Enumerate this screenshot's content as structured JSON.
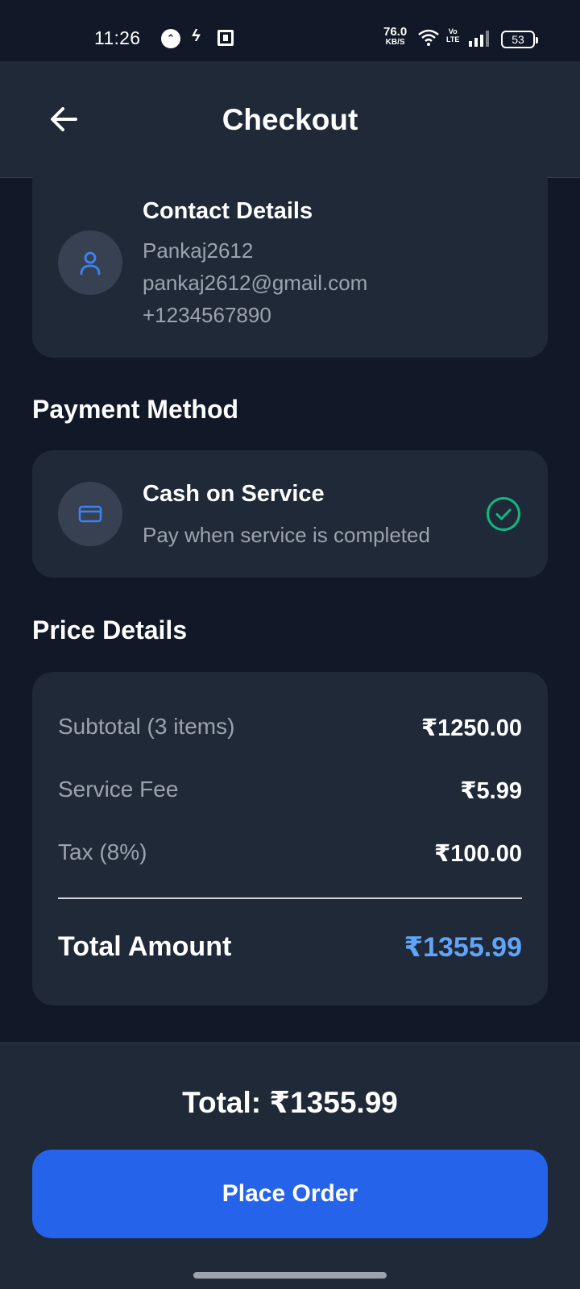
{
  "status_bar": {
    "time": "11:26",
    "net_speed_value": "76.0",
    "net_speed_unit": "KB/S",
    "volte_top": "Vo",
    "volte_bottom": "LTE",
    "battery": "53",
    "icons": [
      "app-notification-icon",
      "bolt-icon",
      "sim-icon",
      "wifi-icon",
      "signal-icon",
      "battery-icon"
    ]
  },
  "header": {
    "title": "Checkout",
    "back_icon": "arrow-left-icon"
  },
  "contact": {
    "heading": "Contact Details",
    "name": "Pankaj2612",
    "email": "pankaj2612@gmail.com",
    "phone": "+1234567890",
    "icon": "user-icon"
  },
  "payment": {
    "section_title": "Payment Method",
    "method": "Cash on Service",
    "description": "Pay when service is completed",
    "selected": true,
    "icon": "credit-card-icon",
    "status_icon": "check-circle-icon"
  },
  "price": {
    "section_title": "Price Details",
    "rows": [
      {
        "label": "Subtotal (3 items)",
        "value": "₹1250.00"
      },
      {
        "label": "Service Fee",
        "value": "₹5.99"
      },
      {
        "label": "Tax (8%)",
        "value": "₹100.00"
      }
    ],
    "total_label": "Total Amount",
    "total_value": "₹1355.99"
  },
  "footer": {
    "total_text": "Total: ₹1355.99",
    "button_label": "Place Order"
  },
  "colors": {
    "background": "#111827",
    "card": "#1f2937",
    "accent": "#2563eb",
    "total_highlight": "#60a5fa",
    "success": "#10b981",
    "muted_text": "#9ca3af"
  }
}
